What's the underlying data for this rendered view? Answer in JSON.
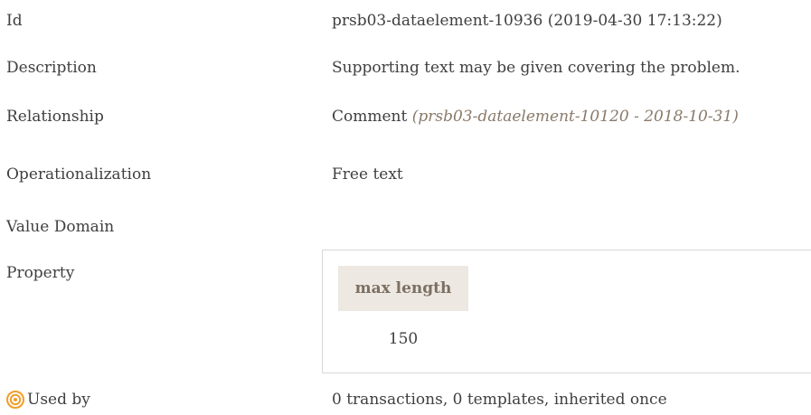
{
  "rows": {
    "id": {
      "label": "Id",
      "value": "prsb03-dataelement-10936 (2019-04-30 17:13:22)"
    },
    "description": {
      "label": "Description",
      "value": "Supporting text may be given covering the problem."
    },
    "relationship": {
      "label": "Relationship",
      "value": "Comment",
      "italic": "(prsb03-dataelement-10120 - 2018-10-31)"
    },
    "operationalization": {
      "label": "Operationalization",
      "value": "Free text"
    },
    "value_domain": {
      "label": "Value Domain"
    },
    "property": {
      "label": "Property",
      "header": "max length",
      "value": "150"
    },
    "used_by": {
      "label": "Used by",
      "value": "0 transactions, 0 templates, inherited once",
      "icon": "target-icon"
    }
  },
  "colors": {
    "text": "#3f3f3f",
    "header_bg": "#ede8e2",
    "header_text": "#7c7063",
    "italic_text": "#8a7a6a",
    "icon_orange": "#f29d2a"
  }
}
